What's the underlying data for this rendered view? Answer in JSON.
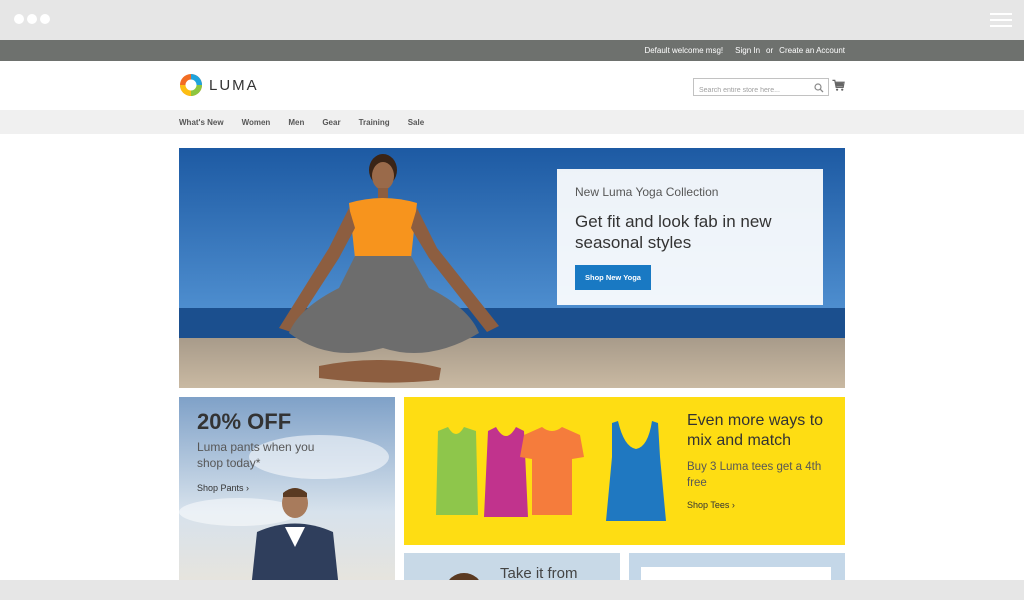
{
  "panel": {
    "welcome": "Default welcome msg!",
    "sign_in": "Sign In",
    "or": "or",
    "create_account": "Create an Account"
  },
  "header": {
    "logo_text": "LUMA",
    "search_placeholder": "Search entire store here...",
    "search_icon": "search-icon",
    "cart_icon": "cart-icon"
  },
  "nav": {
    "items": [
      {
        "label": "What's New"
      },
      {
        "label": "Women"
      },
      {
        "label": "Men"
      },
      {
        "label": "Gear"
      },
      {
        "label": "Training"
      },
      {
        "label": "Sale"
      }
    ]
  },
  "hero": {
    "subtitle": "New Luma Yoga Collection",
    "title": "Get fit and look fab in new seasonal styles",
    "button": "Shop New Yoga"
  },
  "promo_pants": {
    "title": "20% OFF",
    "desc": "Luma pants when you shop today*",
    "link": "Shop Pants ›"
  },
  "promo_tees": {
    "title": "Even more ways to mix and match",
    "desc": "Buy 3 Luma tees get a 4th free",
    "link": "Shop Tees ›"
  },
  "promo_bottom": {
    "text": "Take it from"
  },
  "colors": {
    "primary_button": "#1979c3",
    "panel_bar": "#6e716e",
    "tees_yellow": "#fedd13"
  }
}
